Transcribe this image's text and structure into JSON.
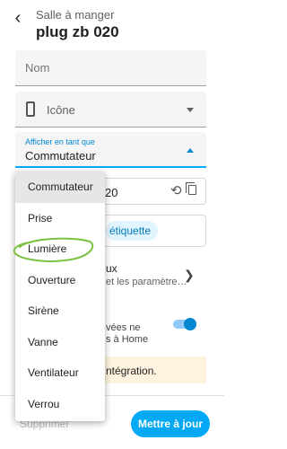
{
  "header": {
    "back_icon": "arrow-back-icon",
    "area": "Salle à manger",
    "device": "plug zb 020"
  },
  "form": {
    "name_placeholder": "Nom",
    "icon_field_label": "Icône",
    "show_as_label": "Afficher en tant que",
    "show_as_value": "Commutateur"
  },
  "entity_row": {
    "visible_suffix": "20",
    "refresh_icon": "refresh-icon",
    "copy_icon": "copy-icon"
  },
  "labels_row": {
    "chip_visible_text": "étiquette"
  },
  "advanced": {
    "title_fragment": "ux",
    "subtitle_fragment": "et les paramètre…"
  },
  "visibility": {
    "line1_fragment": "vées ne",
    "line2_fragment": "s à Home",
    "toggle_on": true
  },
  "warning": {
    "text_fragment": "ntégration."
  },
  "footer": {
    "delete_label": "Supprimer",
    "update_label": "Mettre à jour"
  },
  "dropdown": {
    "selected": "Commutateur",
    "options": [
      "Commutateur",
      "Prise",
      "Lumière",
      "Ouverture",
      "Sirène",
      "Vanne",
      "Ventilateur",
      "Verrou"
    ],
    "circled_option": "Lumière"
  },
  "colors": {
    "primary": "#03a9f4",
    "primary_dark": "#0288d1",
    "annotation": "#7bc142",
    "warning": "#ffa726"
  }
}
